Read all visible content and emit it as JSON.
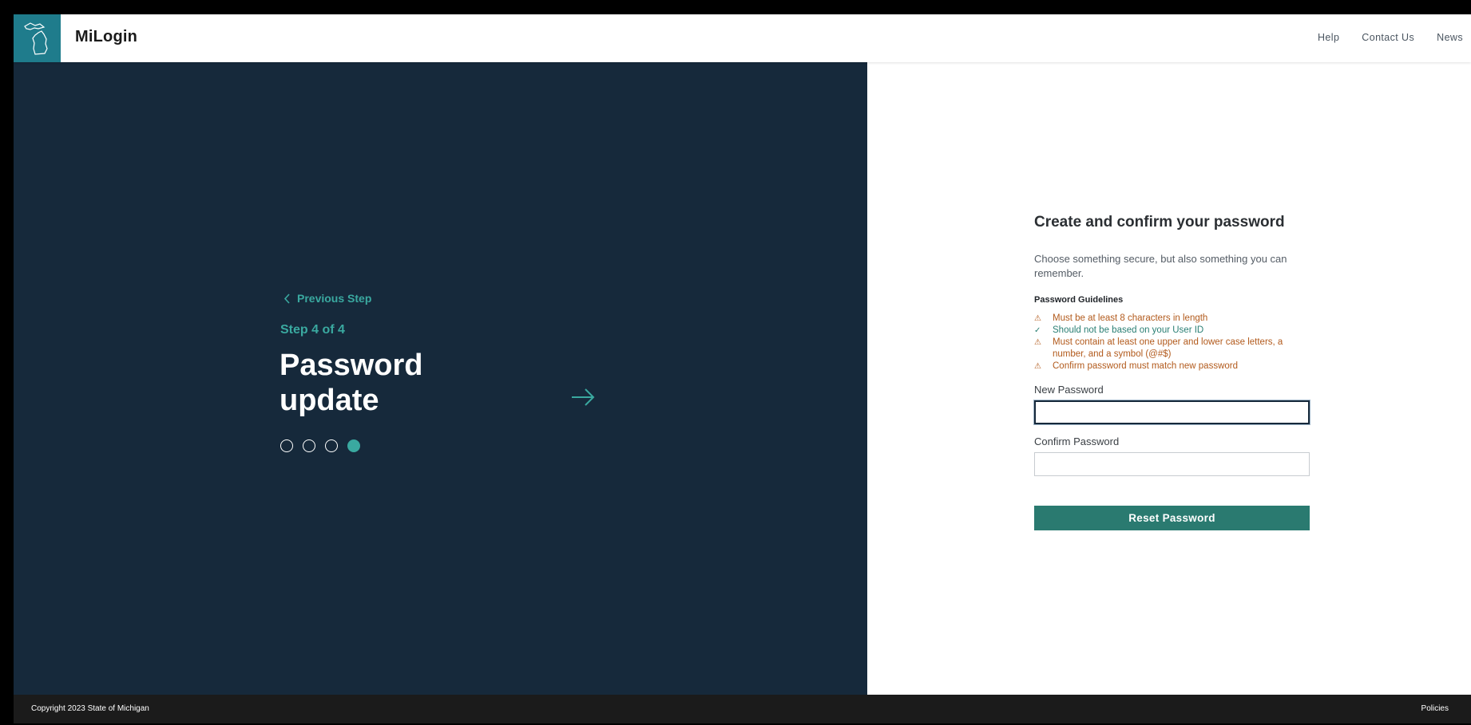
{
  "header": {
    "brand": "MiLogin",
    "nav": [
      "Help",
      "Contact Us",
      "News"
    ]
  },
  "left": {
    "previous": "Previous Step",
    "step": "Step 4 of 4",
    "headline_line1": "Password",
    "headline_line2": "update",
    "progress": {
      "total": 4,
      "current": 4
    }
  },
  "form": {
    "title": "Create and confirm your password",
    "description": "Choose something secure, but also something you can remember.",
    "guidelines_title": "Password Guidelines",
    "rules": [
      {
        "status": "warning",
        "text": "Must be at least 8 characters in length"
      },
      {
        "status": "ok",
        "text": "Should not be based on your User ID"
      },
      {
        "status": "warning",
        "text": "Must contain at least one upper and lower case letters, a number, and a symbol (@#$)"
      },
      {
        "status": "warning",
        "text": "Confirm password must match new password"
      }
    ],
    "new_password_label": "New Password",
    "new_password_value": "",
    "confirm_password_label": "Confirm Password",
    "confirm_password_value": "",
    "submit_label": "Reset Password"
  },
  "footer": {
    "copyright": "Copyright 2023 State of Michigan",
    "policies": "Policies"
  },
  "colors": {
    "navy": "#16293b",
    "teal": "#3aa9a0",
    "button": "#2a7a70",
    "warning": "#b25a1c",
    "logo_bg": "#1f7c8c"
  }
}
